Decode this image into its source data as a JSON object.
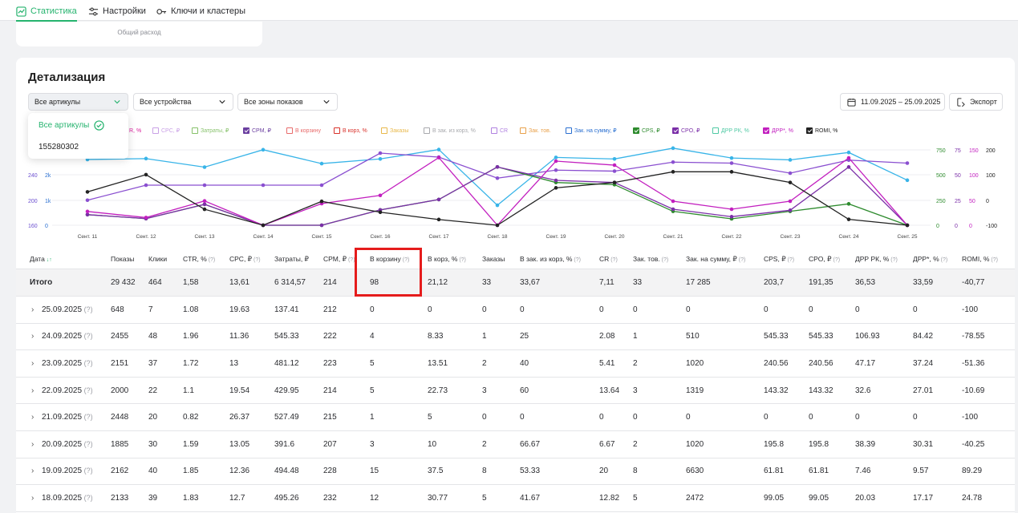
{
  "nav": {
    "tabs": [
      {
        "label": "Статистика",
        "icon": "chart-icon",
        "active": true
      },
      {
        "label": "Настройки",
        "icon": "sliders-icon",
        "active": false
      },
      {
        "label": "Ключи и кластеры",
        "icon": "key-icon",
        "active": false
      }
    ]
  },
  "summary_card": {
    "label": "Общий расход"
  },
  "section": {
    "title": "Детализация"
  },
  "filters": {
    "articles": "Все артикулы",
    "devices": "Все устройства",
    "zones": "Все зоны показов"
  },
  "dropdown": {
    "options": [
      "Все артикулы",
      "155280302"
    ],
    "selected": "Все артикулы"
  },
  "date_range": "11.09.2025 – 25.09.2025",
  "export_label": "Экспорт",
  "legend": [
    {
      "label": "R, %",
      "color": "#d81b9a",
      "checked": false
    },
    {
      "label": "CPC, ₽",
      "color": "#c9a0e6",
      "checked": false
    },
    {
      "label": "Затраты, ₽",
      "color": "#86c16a",
      "checked": false
    },
    {
      "label": "CPM, ₽",
      "color": "#6b3fa0",
      "checked": true
    },
    {
      "label": "В корзину",
      "color": "#e86b6b",
      "checked": false
    },
    {
      "label": "В корз, %",
      "color": "#d9322b",
      "checked": false
    },
    {
      "label": "Заказы",
      "color": "#e8b84a",
      "checked": false
    },
    {
      "label": "В зак. из корз, %",
      "color": "#a8a9ad",
      "checked": false
    },
    {
      "label": "CR",
      "color": "#b080e0",
      "checked": false
    },
    {
      "label": "Зак. тов.",
      "color": "#e8a04a",
      "checked": false
    },
    {
      "label": "Зак. на сумму, ₽",
      "color": "#2a6fd0",
      "checked": false
    },
    {
      "label": "CPS, ₽",
      "color": "#2e8b2e",
      "checked": true
    },
    {
      "label": "CPO, ₽",
      "color": "#7b2fa8",
      "checked": true
    },
    {
      "label": "ДРР РК, %",
      "color": "#4fc9a4",
      "checked": false
    },
    {
      "label": "ДРР*, %",
      "color": "#c21fbf",
      "checked": true
    },
    {
      "label": "ROMI, %",
      "color": "#222222",
      "checked": true
    }
  ],
  "chart_data": {
    "type": "line",
    "x": [
      "Сент. 11",
      "Сент. 12",
      "Сент. 13",
      "Сент. 14",
      "Сент. 15",
      "Сент. 16",
      "Сент. 17",
      "Сент. 18",
      "Сент. 19",
      "Сент. 20",
      "Сент. 21",
      "Сент. 22",
      "Сент. 23",
      "Сент. 24",
      "Сент. 25"
    ],
    "axes": {
      "left_inner": {
        "ticks": [
          "240",
          "200",
          "160"
        ],
        "color": "#6b4fd0"
      },
      "left_outer": {
        "ticks": [
          "2k",
          "1k",
          "0"
        ],
        "color": "#2a6fd0"
      },
      "right_1": {
        "ticks": [
          "750",
          "500",
          "250",
          "0"
        ],
        "color": "#2e8b2e"
      },
      "right_2": {
        "ticks": [
          "150",
          "100",
          "50",
          "0"
        ],
        "color": "#7b2fa8"
      },
      "right_3": {
        "ticks": [
          "200",
          "100",
          "0",
          "-100"
        ],
        "color": "#222222"
      },
      "right_2b": {
        "ticks": [
          "75",
          "50",
          "25",
          "0"
        ],
        "color": "#c21fbf"
      }
    },
    "series": [
      {
        "key": "shows",
        "color": "#38b4e8",
        "values": [
          2133,
          2162,
          1885,
          2448,
          2000,
          2151,
          2455,
          648,
          2200,
          2150,
          2500,
          2180,
          2120,
          2360,
          1460
        ]
      },
      {
        "key": "cpm",
        "color": "#8a4fd0",
        "values": [
          185,
          200,
          200,
          200,
          200,
          232,
          228,
          207,
          215,
          214,
          223,
          222,
          212,
          225,
          222
        ]
      },
      {
        "key": "cps",
        "color": "#2e8b2e",
        "values": [
          99.05,
          61.81,
          195.8,
          0,
          0,
          143.32,
          240.56,
          545.33,
          400,
          380,
          130,
          60,
          130,
          200,
          0
        ]
      },
      {
        "key": "cpo",
        "color": "#7b2fa8",
        "values": [
          99.05,
          61.81,
          195.8,
          0,
          0,
          143.32,
          240.56,
          545.33,
          420,
          400,
          150,
          80,
          140,
          545,
          0
        ]
      },
      {
        "key": "drr",
        "color": "#c21fbf",
        "values": [
          17.17,
          9.57,
          30.31,
          0,
          27.01,
          37.24,
          84.42,
          0,
          80,
          75,
          30,
          20,
          30,
          84,
          0
        ]
      },
      {
        "key": "romi",
        "color": "#222222",
        "values": [
          24.78,
          89.29,
          -40.25,
          -100,
          -10.69,
          -51.36,
          -78.55,
          -100,
          40,
          60,
          100,
          100,
          60,
          -78,
          -100
        ]
      }
    ]
  },
  "table": {
    "headers": [
      {
        "label": "Дата",
        "q": "↓↑"
      },
      {
        "label": "Показы",
        "q": ""
      },
      {
        "label": "Клики",
        "q": ""
      },
      {
        "label": "CTR, %",
        "q": "(?)"
      },
      {
        "label": "CPC, ₽",
        "q": "(?)"
      },
      {
        "label": "Затраты, ₽",
        "q": ""
      },
      {
        "label": "CPM, ₽",
        "q": "(?)"
      },
      {
        "label": "В корзину",
        "q": "(?)"
      },
      {
        "label": "В корз, %",
        "q": "(?)"
      },
      {
        "label": "Заказы",
        "q": ""
      },
      {
        "label": "В зак. из корз, %",
        "q": "(?)"
      },
      {
        "label": "CR",
        "q": "(?)"
      },
      {
        "label": "Зак. тов.",
        "q": "(?)"
      },
      {
        "label": "Зак. на сумму, ₽",
        "q": "(?)"
      },
      {
        "label": "CPS, ₽",
        "q": "(?)"
      },
      {
        "label": "CPO, ₽",
        "q": "(?)"
      },
      {
        "label": "ДРР РК, %",
        "q": "(?)"
      },
      {
        "label": "ДРР*, %",
        "q": "(?)"
      },
      {
        "label": "ROMI, %",
        "q": "(?)"
      }
    ],
    "total": [
      "Итого",
      "29 432",
      "464",
      "1,58",
      "13,61",
      "6 314,57",
      "214",
      "98",
      "21,12",
      "33",
      "33,67",
      "7,11",
      "33",
      "17 285",
      "203,7",
      "191,35",
      "36,53",
      "33,59",
      "-40,77"
    ],
    "rows": [
      [
        "25.09.2025",
        "648",
        "7",
        "1.08",
        "19.63",
        "137.41",
        "212",
        "0",
        "0",
        "0",
        "0",
        "0",
        "0",
        "0",
        "0",
        "0",
        "0",
        "0",
        "-100"
      ],
      [
        "24.09.2025",
        "2455",
        "48",
        "1.96",
        "11.36",
        "545.33",
        "222",
        "4",
        "8.33",
        "1",
        "25",
        "2.08",
        "1",
        "510",
        "545.33",
        "545.33",
        "106.93",
        "84.42",
        "-78.55"
      ],
      [
        "23.09.2025",
        "2151",
        "37",
        "1.72",
        "13",
        "481.12",
        "223",
        "5",
        "13.51",
        "2",
        "40",
        "5.41",
        "2",
        "1020",
        "240.56",
        "240.56",
        "47.17",
        "37.24",
        "-51.36"
      ],
      [
        "22.09.2025",
        "2000",
        "22",
        "1.1",
        "19.54",
        "429.95",
        "214",
        "5",
        "22.73",
        "3",
        "60",
        "13.64",
        "3",
        "1319",
        "143.32",
        "143.32",
        "32.6",
        "27.01",
        "-10.69"
      ],
      [
        "21.09.2025",
        "2448",
        "20",
        "0.82",
        "26.37",
        "527.49",
        "215",
        "1",
        "5",
        "0",
        "0",
        "0",
        "0",
        "0",
        "0",
        "0",
        "0",
        "0",
        "-100"
      ],
      [
        "20.09.2025",
        "1885",
        "30",
        "1.59",
        "13.05",
        "391.6",
        "207",
        "3",
        "10",
        "2",
        "66.67",
        "6.67",
        "2",
        "1020",
        "195.8",
        "195.8",
        "38.39",
        "30.31",
        "-40.25"
      ],
      [
        "19.09.2025",
        "2162",
        "40",
        "1.85",
        "12.36",
        "494.48",
        "228",
        "15",
        "37.5",
        "8",
        "53.33",
        "20",
        "8",
        "6630",
        "61.81",
        "61.81",
        "7.46",
        "9.57",
        "89.29"
      ],
      [
        "18.09.2025",
        "2133",
        "39",
        "1.83",
        "12.7",
        "495.26",
        "232",
        "12",
        "30.77",
        "5",
        "41.67",
        "12.82",
        "5",
        "2472",
        "99.05",
        "99.05",
        "20.03",
        "17.17",
        "24.78"
      ]
    ],
    "row_help": "(?)",
    "row_chevron": "›"
  }
}
